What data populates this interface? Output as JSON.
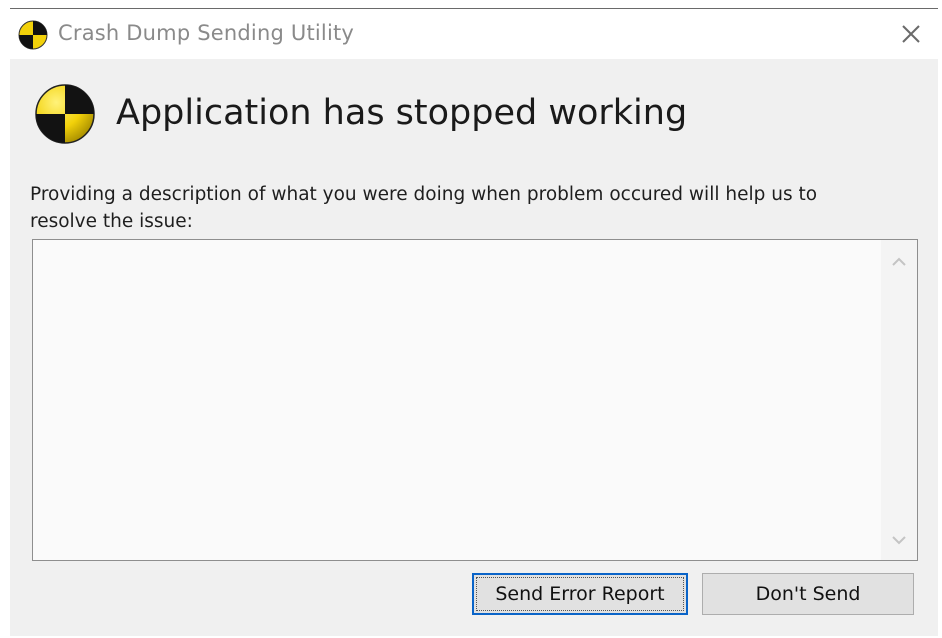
{
  "window": {
    "title": "Crash Dump Sending Utility"
  },
  "main": {
    "heading": "Application has stopped working",
    "description": "Providing a description of what you were doing when problem occured will help us to resolve the issue:",
    "textarea_value": ""
  },
  "buttons": {
    "send_label": "Send Error Report",
    "dont_send_label": "Don't Send"
  },
  "icons": {
    "app": "crash-test-icon",
    "close": "close-icon",
    "scroll_up": "chevron-up-icon",
    "scroll_down": "chevron-down-icon"
  },
  "colors": {
    "icon_yellow": "#f2d10a",
    "icon_black": "#111111",
    "focus_border": "#0a64c8"
  }
}
